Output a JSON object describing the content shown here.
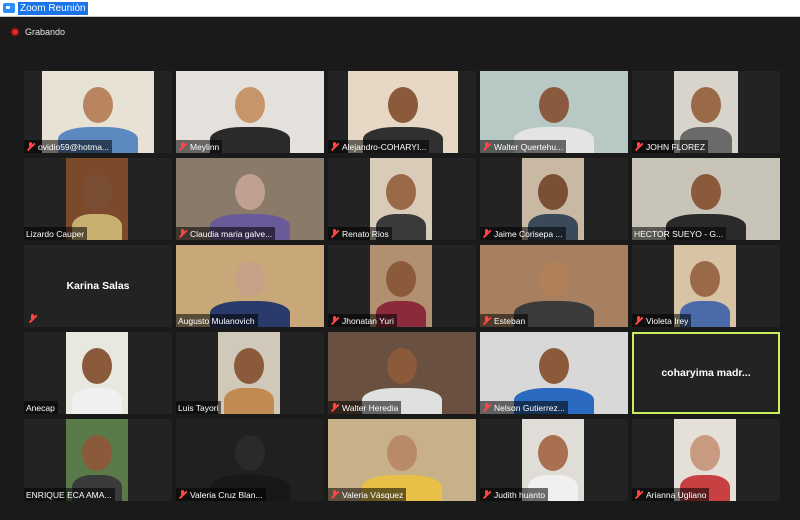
{
  "window": {
    "title": "Zoom Reunión"
  },
  "recording": {
    "label": "Grabando"
  },
  "participants": [
    {
      "name": "ovidio59@hotma...",
      "muted": true,
      "bg": "#e8e2d4",
      "skin": "#b88560",
      "shirt": "#5c8ac0"
    },
    {
      "name": "Meylinn",
      "muted": true,
      "bg": "#e4e0dc",
      "skin": "#c7956a",
      "shirt": "#2a2a2a"
    },
    {
      "name": "Alejandro-COHARYI...",
      "muted": true,
      "bg": "#e6d8c4",
      "skin": "#8a5a3a",
      "shirt": "#303030"
    },
    {
      "name": "Walter Quertehu...",
      "muted": true,
      "bg": "#b8c8c4",
      "skin": "#8a5a3e",
      "shirt": "#e4e4e4"
    },
    {
      "name": "JOHN FLOREZ",
      "muted": true,
      "bg": "#d8d4cc",
      "skin": "#9a6a48",
      "shirt": "#6a6a6a"
    },
    {
      "name": "Lizardo Cauper",
      "muted": false,
      "bg": "#7a4a2a",
      "skin": "#7a4e32",
      "shirt": "#c8b070"
    },
    {
      "name": "Claudia maria galve...",
      "muted": true,
      "bg": "#8a7a6a",
      "skin": "#c0a090",
      "shirt": "#6a5a9a"
    },
    {
      "name": "Renato Rios",
      "muted": true,
      "bg": "#d8ccb8",
      "skin": "#9a6a48",
      "shirt": "#3a3a3a"
    },
    {
      "name": "Jaime Corisepa ...",
      "muted": true,
      "bg": "#c8b8a4",
      "skin": "#7a5034",
      "shirt": "#3a4a5a"
    },
    {
      "name": "HECTOR SUEYO - G...",
      "muted": false,
      "bg": "#c8c4b8",
      "skin": "#8a5a3a",
      "shirt": "#2a2a2a"
    },
    {
      "name": "Karina Salas",
      "muted": true,
      "video": false,
      "bg": "#232323"
    },
    {
      "name": "Augusto Mulanovich",
      "muted": false,
      "bg": "#c8a878",
      "skin": "#c8a088",
      "shirt": "#2a3a6a"
    },
    {
      "name": "Jhonatan Yuri",
      "muted": true,
      "bg": "#b09070",
      "skin": "#8a5a3a",
      "shirt": "#8a2a3a"
    },
    {
      "name": "Esteban",
      "muted": true,
      "bg": "#a88060",
      "skin": "#b0805a",
      "shirt": "#3a3a3a"
    },
    {
      "name": "Violeta Irey",
      "muted": true,
      "bg": "#d8c4a4",
      "skin": "#9a6a48",
      "shirt": "#4a6aaa"
    },
    {
      "name": "Anecap",
      "muted": false,
      "bg": "#e8e8e0",
      "skin": "#8a5a3a",
      "shirt": "#f0f0f0"
    },
    {
      "name": "Luis Tayori",
      "muted": false,
      "bg": "#d0c8b8",
      "skin": "#8a5a3a",
      "shirt": "#c08a50"
    },
    {
      "name": "Walter Heredia",
      "muted": true,
      "bg": "#6a5040",
      "skin": "#8a5a3a",
      "shirt": "#e0e0e0"
    },
    {
      "name": "Nelson Gutierrez...",
      "muted": true,
      "bg": "#d8d8d8",
      "skin": "#8a5a3a",
      "shirt": "#2a6ac0"
    },
    {
      "name": "coharyima madr...",
      "muted": false,
      "video": false,
      "active": true,
      "bg": "#232323"
    },
    {
      "name": "ENRIQUE ECA AMA...",
      "muted": false,
      "bg": "#5a7a4a",
      "skin": "#8a5a3a",
      "shirt": "#3a3a3a"
    },
    {
      "name": "Valeria Cruz Blan...",
      "muted": true,
      "bg": "#202020",
      "skin": "#2a2a2a",
      "shirt": "#181818"
    },
    {
      "name": "Valeria Vásquez",
      "muted": true,
      "bg": "#c8b088",
      "skin": "#b88a68",
      "shirt": "#e8c048"
    },
    {
      "name": "Judith huanto",
      "muted": true,
      "bg": "#e0dcd8",
      "skin": "#a87050",
      "shirt": "#f0f0f0"
    },
    {
      "name": "Arianna Ugliano",
      "muted": true,
      "bg": "#e4e0d8",
      "skin": "#c89a80",
      "shirt": "#c84040"
    }
  ]
}
